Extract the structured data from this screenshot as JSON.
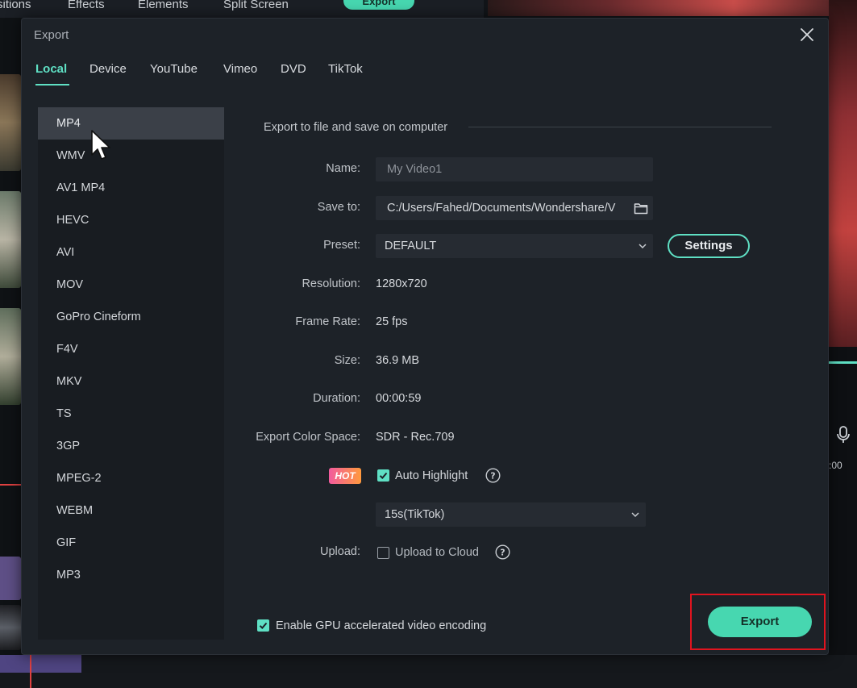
{
  "background": {
    "toolbar_tabs": [
      "sitions",
      "Effects",
      "Elements",
      "Split Screen"
    ],
    "export_label": "Export",
    "timestamp_fragment": ":00"
  },
  "dialog": {
    "title": "Export",
    "tabs": [
      "Local",
      "Device",
      "YouTube",
      "Vimeo",
      "DVD",
      "TikTok"
    ],
    "active_tab": "Local",
    "formats": [
      "MP4",
      "WMV",
      "AV1 MP4",
      "HEVC",
      "AVI",
      "MOV",
      "GoPro Cineform",
      "F4V",
      "MKV",
      "TS",
      "3GP",
      "MPEG-2",
      "WEBM",
      "GIF",
      "MP3"
    ],
    "selected_format": "MP4",
    "heading": "Export to file and save on computer",
    "name_label": "Name:",
    "name_placeholder": "My Video1",
    "save_label": "Save to:",
    "save_path": "C:/Users/Fahed/Documents/Wondershare/V",
    "preset_label": "Preset:",
    "preset_value": "DEFAULT",
    "settings_label": "Settings",
    "resolution_label": "Resolution:",
    "resolution_value": "1280x720",
    "framerate_label": "Frame Rate:",
    "framerate_value": "25 fps",
    "size_label": "Size:",
    "size_value": "36.9 MB",
    "duration_label": "Duration:",
    "duration_value": "00:00:59",
    "colorspace_label": "Export Color Space:",
    "colorspace_value": "SDR - Rec.709",
    "hot_badge": "HOT",
    "auto_highlight_label": "Auto Highlight",
    "auto_highlight_checked": true,
    "highlight_duration": "15s(TikTok)",
    "upload_label": "Upload:",
    "upload_cloud_label": "Upload to Cloud",
    "upload_cloud_checked": false,
    "gpu_label": "Enable GPU accelerated video encoding",
    "gpu_checked": true,
    "export_label": "Export"
  },
  "colors": {
    "accent": "#5fe0c4",
    "export_button": "#47d7b0",
    "highlight_box": "#e0141f"
  }
}
